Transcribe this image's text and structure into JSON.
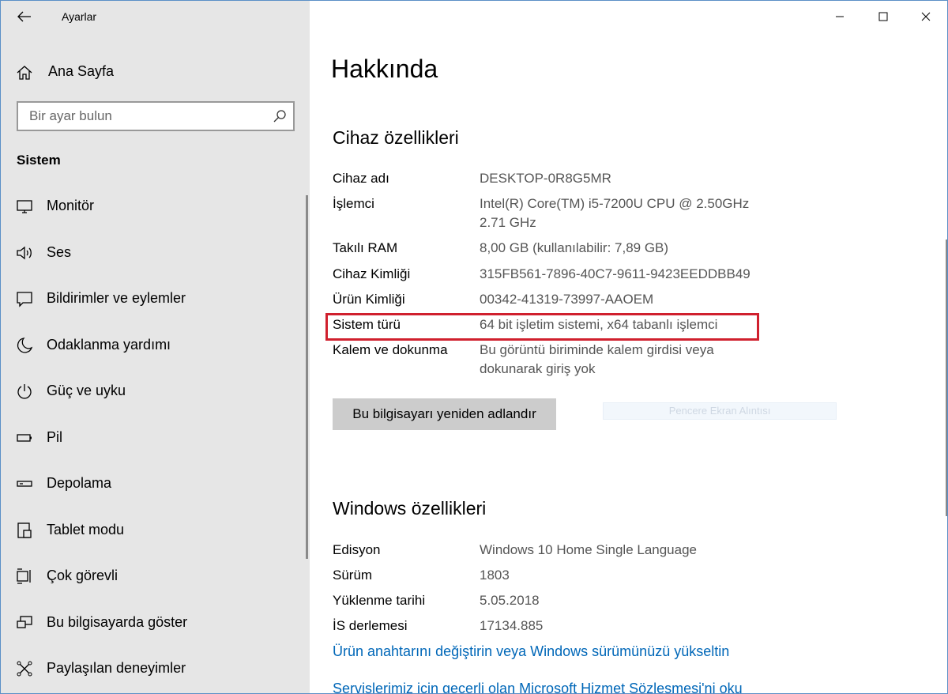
{
  "window": {
    "title": "Ayarlar"
  },
  "sidebar": {
    "home_label": "Ana Sayfa",
    "search_placeholder": "Bir ayar bulun",
    "section_title": "Sistem",
    "items": [
      {
        "label": "Monitör",
        "icon": "monitor-icon"
      },
      {
        "label": "Ses",
        "icon": "speaker-icon"
      },
      {
        "label": "Bildirimler ve eylemler",
        "icon": "notification-icon"
      },
      {
        "label": "Odaklanma yardımı",
        "icon": "moon-icon"
      },
      {
        "label": "Güç ve uyku",
        "icon": "power-icon"
      },
      {
        "label": "Pil",
        "icon": "battery-icon"
      },
      {
        "label": "Depolama",
        "icon": "storage-icon"
      },
      {
        "label": "Tablet modu",
        "icon": "tablet-icon"
      },
      {
        "label": "Çok görevli",
        "icon": "multitask-icon"
      },
      {
        "label": "Bu bilgisayarda göster",
        "icon": "project-icon"
      },
      {
        "label": "Paylaşılan deneyimler",
        "icon": "shared-icon"
      }
    ]
  },
  "main": {
    "title": "Hakkında",
    "device_section": {
      "title": "Cihaz özellikleri",
      "specs": [
        {
          "label": "Cihaz adı",
          "value": "DESKTOP-0R8G5MR"
        },
        {
          "label": "İşlemci",
          "value": "Intel(R) Core(TM) i5-7200U CPU @ 2.50GHz 2.71 GHz"
        },
        {
          "label": "Takılı RAM",
          "value": "8,00 GB (kullanılabilir: 7,89 GB)"
        },
        {
          "label": "Cihaz Kimliği",
          "value": "315FB561-7896-40C7-9611-9423EEDDBB49"
        },
        {
          "label": "Ürün Kimliği",
          "value": "00342-41319-73997-AAOEM"
        },
        {
          "label": "Sistem türü",
          "value": "64 bit işletim sistemi, x64 tabanlı işlemci"
        },
        {
          "label": "Kalem ve dokunma",
          "value": "Bu görüntü biriminde kalem girdisi veya dokunarak giriş yok"
        }
      ],
      "rename_button": "Bu bilgisayarı yeniden adlandır",
      "snip_overlay": "Pencere Ekran Alıntısı"
    },
    "windows_section": {
      "title": "Windows özellikleri",
      "specs": [
        {
          "label": "Edisyon",
          "value": "Windows 10 Home Single Language"
        },
        {
          "label": "Sürüm",
          "value": "1803"
        },
        {
          "label": "Yüklenme tarihi",
          "value": "5.05.2018"
        },
        {
          "label": "İS derlemesi",
          "value": "17134.885"
        }
      ],
      "links": [
        "Ürün anahtarını değiştirin veya Windows sürümünüzü yükseltin",
        "Servislerimiz için geçerli olan Microsoft Hizmet Sözleşmesi'ni oku"
      ]
    }
  },
  "colors": {
    "accent_link": "#0067b8",
    "highlight": "#d0202e",
    "sidebar_bg": "#e6e6e6"
  }
}
